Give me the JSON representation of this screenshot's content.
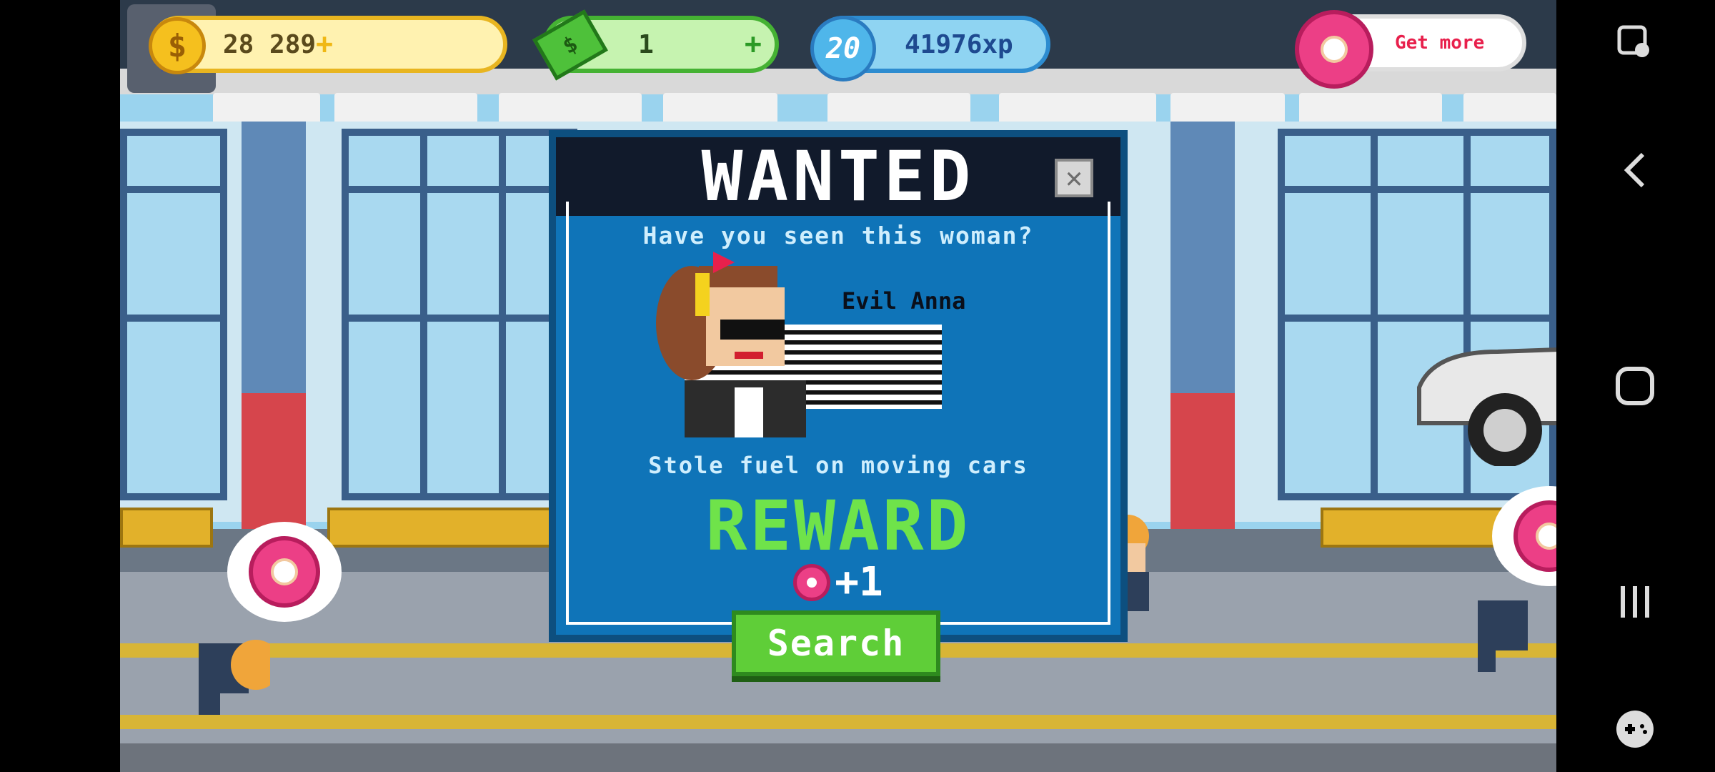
{
  "hud": {
    "coins": "28 289",
    "cash": "1",
    "level": "20",
    "xp": "41976xp",
    "donut_action": "Get more"
  },
  "modal": {
    "title": "WANTED",
    "question": "Have you seen this woman?",
    "name": "Evil Anna",
    "crime": "Stole fuel on moving cars",
    "reward_title": "REWARD",
    "reward_amount": "+1",
    "search_label": "Search"
  },
  "colors": {
    "reward_green": "#6fe34a",
    "modal_blue": "#0f74b8",
    "button_green": "#5fce38",
    "donut_pink": "#ec3f86"
  },
  "icons": [
    "settings-icon",
    "coin-icon",
    "cash-icon",
    "xp-badge-icon",
    "donut-icon",
    "close-icon",
    "back-icon",
    "home-icon",
    "recents-icon",
    "game-tools-icon"
  ]
}
